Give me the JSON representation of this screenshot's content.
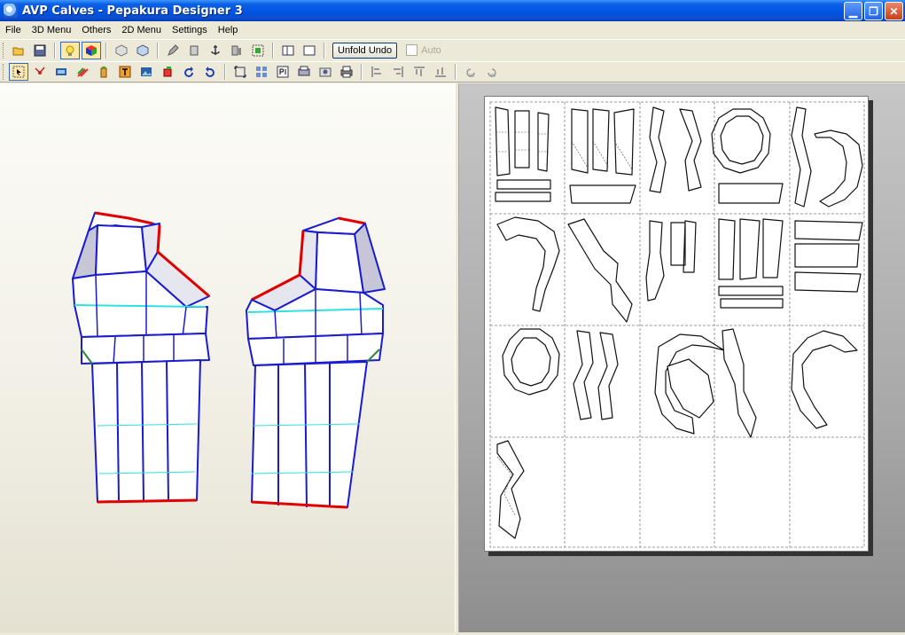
{
  "window": {
    "title": "AVP Calves - Pepakura Designer 3"
  },
  "menu": [
    "File",
    "3D Menu",
    "Others",
    "2D Menu",
    "Settings",
    "Help"
  ],
  "toolbar1": {
    "icons": [
      "open-icon",
      "save-icon",
      "light-icon",
      "texture-icon",
      "cube-front-icon",
      "cube-side-icon",
      "pencil-icon",
      "cylinder-icon",
      "anchor-icon",
      "wall-icon",
      "group-icon",
      "single-view-icon",
      "dual-view-icon"
    ],
    "unfold_undo_label": "Unfold Undo",
    "auto_label": "Auto"
  },
  "toolbar2": {
    "icons": [
      "select-icon",
      "edge-edit-icon",
      "film-icon",
      "pen-tools-icon",
      "glue-icon",
      "text-icon",
      "image-icon",
      "part-icon",
      "rotate-left-icon",
      "rotate-right-icon",
      "fit-icon",
      "arrange-icon",
      "page-number-icon",
      "print-setup-icon",
      "snapshot-icon",
      "print-icon",
      "align-left-icon",
      "align-center-icon",
      "align-top-icon",
      "align-middle-icon",
      "rotate-90-ccw-icon",
      "rotate-90-cw-icon"
    ]
  },
  "colors": {
    "cut_edge": "#e00000",
    "fold_edge": "#1a1ad0",
    "valley_edge": "#2fe0e0",
    "face": "#ffffff"
  }
}
